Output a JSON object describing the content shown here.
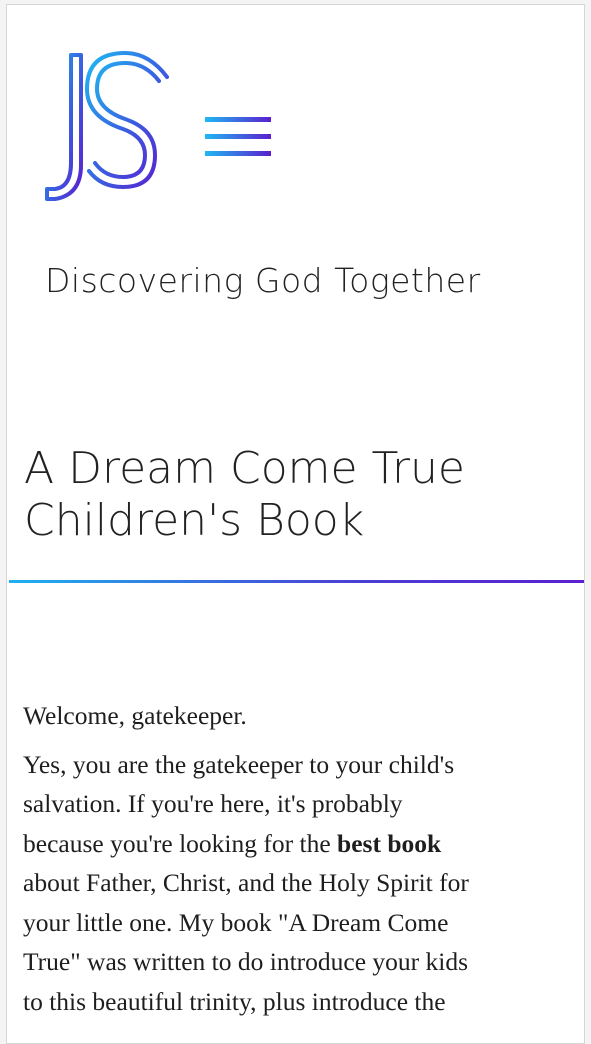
{
  "header": {
    "logo_text": "JS",
    "menu_icon": "hamburger-menu-icon",
    "tagline": "Discovering God Together"
  },
  "page": {
    "title_line1": "A Dream Come True",
    "title_line2": "Children's Book"
  },
  "content": {
    "greeting": "Welcome, gatekeeper.",
    "para_lines": [
      "Yes, you are the gatekeeper to your child's",
      "salvation. If you're here, it's probably",
      "because you're looking for the ",
      "best book",
      "about Father, Christ, and the Holy Spirit for",
      "your little one. My book \"A Dream Come",
      "True\" was written to do introduce your kids",
      "to this beautiful trinity, plus introduce the"
    ]
  },
  "colors": {
    "gradient_start": "#1fb0f0",
    "gradient_end": "#5b1fcf",
    "text": "#222222"
  }
}
